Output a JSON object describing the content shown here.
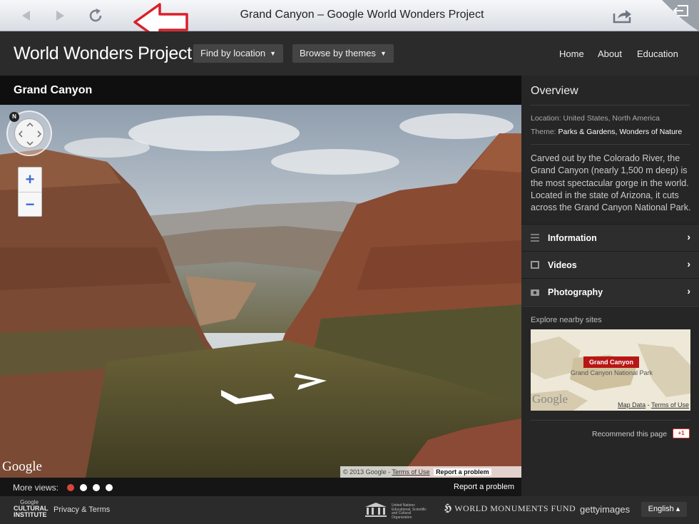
{
  "browser": {
    "title": "Grand Canyon – Google World Wonders Project"
  },
  "header": {
    "brand": "World Wonders Project",
    "find_by_location": "Find by location",
    "browse_by_themes": "Browse by themes",
    "nav": [
      "Home",
      "About",
      "Education"
    ]
  },
  "page": {
    "title": "Grand Canyon"
  },
  "viewer": {
    "compass_north": "N",
    "zoom_in": "+",
    "zoom_out": "−",
    "google_logo": "Google",
    "copyright": "© 2013 Google -",
    "terms": "Terms of Use",
    "report_problem": "Report a problem",
    "more_views_label": "More views:",
    "more_views_count": 4,
    "more_views_active": 0,
    "report_problem_strip": "Report a problem"
  },
  "sidebar": {
    "overview_title": "Overview",
    "location_label": "Location:",
    "location_value": "United States, North America",
    "theme_label": "Theme:",
    "theme_value": "Parks & Gardens, Wonders of Nature",
    "description": "Carved out by the Colorado River, the Grand Canyon (nearly 1,500 m deep) is the most spectacular gorge in the world. Located in the state of Arizona, it cuts across the Grand Canyon National Park.",
    "sections": [
      {
        "label": "Information",
        "icon": "list-icon"
      },
      {
        "label": "Videos",
        "icon": "film-icon"
      },
      {
        "label": "Photography",
        "icon": "camera-icon"
      }
    ],
    "nearby_label": "Explore nearby sites",
    "map_pin": "Grand Canyon",
    "map_place": "Grand Canyon National Park",
    "map_logo": "Google",
    "map_data": "Map Data",
    "map_terms": "Terms of Use",
    "recommend": "Recommend this page",
    "gplus": "+1"
  },
  "footer": {
    "cultural_google": "Google",
    "cultural_name": "CULTURAL INSTITUTE",
    "privacy": "Privacy & Terms",
    "unesco_text": "United Nations Educational, Scientific and Cultural Organization",
    "wmf": "WORLD MONUMENTS FUND",
    "getty": "gettyimages",
    "language": "English ▴"
  },
  "colors": {
    "active_dot": "#d9453a",
    "map_pin": "#b81616",
    "zoom_blue": "#3b6bd6"
  }
}
